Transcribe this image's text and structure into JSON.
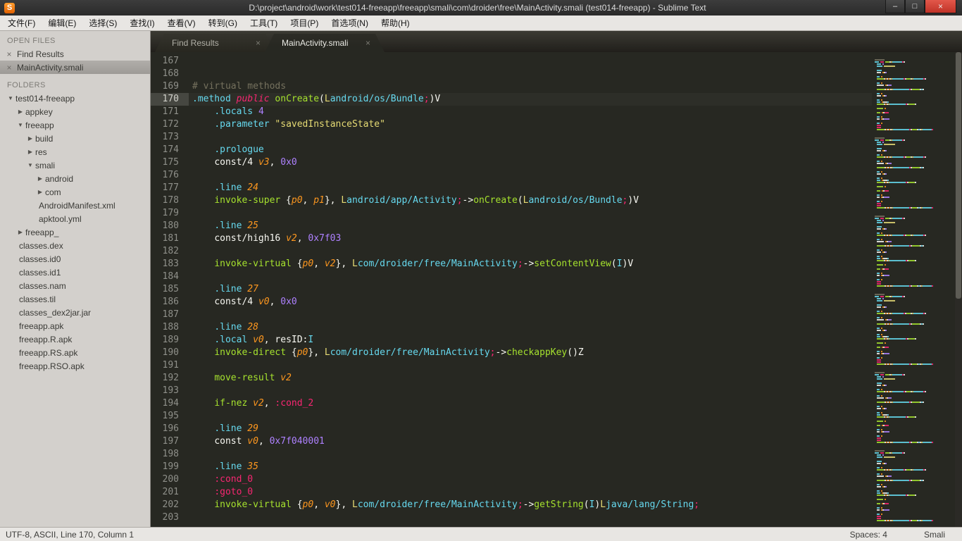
{
  "window": {
    "title": "D:\\project\\android\\work\\test014-freeapp\\freeapp\\smali\\com\\droider\\free\\MainActivity.smali (test014-freeapp) - Sublime Text",
    "controls": {
      "minimize": "–",
      "maximize": "□",
      "close": "×"
    },
    "app_icon_letter": "S"
  },
  "menu_bar": {
    "items": [
      "文件(F)",
      "编辑(E)",
      "选择(S)",
      "查找(I)",
      "查看(V)",
      "转到(G)",
      "工具(T)",
      "项目(P)",
      "首选项(N)",
      "帮助(H)"
    ]
  },
  "sidebar": {
    "open_files_header": "OPEN FILES",
    "open_files": [
      {
        "label": "Find Results",
        "selected": false
      },
      {
        "label": "MainActivity.smali",
        "selected": true
      }
    ],
    "folders_header": "FOLDERS",
    "tree": [
      {
        "label": "test014-freeapp",
        "level": 0,
        "type": "folder",
        "expanded": true
      },
      {
        "label": "appkey",
        "level": 1,
        "type": "folder",
        "expanded": false
      },
      {
        "label": "freeapp",
        "level": 1,
        "type": "folder",
        "expanded": true
      },
      {
        "label": "build",
        "level": 2,
        "type": "folder",
        "expanded": false
      },
      {
        "label": "res",
        "level": 2,
        "type": "folder",
        "expanded": false
      },
      {
        "label": "smali",
        "level": 2,
        "type": "folder",
        "expanded": true
      },
      {
        "label": "android",
        "level": 3,
        "type": "folder",
        "expanded": false
      },
      {
        "label": "com",
        "level": 3,
        "type": "folder",
        "expanded": false
      },
      {
        "label": "AndroidManifest.xml",
        "level": 3,
        "type": "file"
      },
      {
        "label": "apktool.yml",
        "level": 3,
        "type": "file"
      },
      {
        "label": "freeapp_",
        "level": 1,
        "type": "folder",
        "expanded": false
      },
      {
        "label": "classes.dex",
        "level": 1,
        "type": "file"
      },
      {
        "label": "classes.id0",
        "level": 1,
        "type": "file"
      },
      {
        "label": "classes.id1",
        "level": 1,
        "type": "file"
      },
      {
        "label": "classes.nam",
        "level": 1,
        "type": "file"
      },
      {
        "label": "classes.til",
        "level": 1,
        "type": "file"
      },
      {
        "label": "classes_dex2jar.jar",
        "level": 1,
        "type": "file"
      },
      {
        "label": "freeapp.apk",
        "level": 1,
        "type": "file"
      },
      {
        "label": "freeapp.R.apk",
        "level": 1,
        "type": "file"
      },
      {
        "label": "freeapp.RS.apk",
        "level": 1,
        "type": "file"
      },
      {
        "label": "freeapp.RSO.apk",
        "level": 1,
        "type": "file"
      }
    ]
  },
  "tabs": [
    {
      "label": "Find Results",
      "active": false
    },
    {
      "label": "MainActivity.smali",
      "active": true
    }
  ],
  "editor": {
    "active_line": 170,
    "lines": [
      {
        "num": 167,
        "tokens": []
      },
      {
        "num": 168,
        "tokens": []
      },
      {
        "num": 169,
        "tokens": [
          [
            "cm",
            "# virtual methods"
          ]
        ]
      },
      {
        "num": 170,
        "tokens": [
          [
            "c",
            ".method"
          ],
          [
            "w",
            " "
          ],
          [
            "pi",
            "public"
          ],
          [
            "w",
            " "
          ],
          [
            "g",
            "onCreate"
          ],
          [
            "w",
            "("
          ],
          [
            "y",
            "L"
          ],
          [
            "c",
            "android/os/Bundle"
          ],
          [
            "p",
            ";"
          ],
          [
            "w",
            ")V"
          ]
        ]
      },
      {
        "num": 171,
        "tokens": [
          [
            "w",
            "    "
          ],
          [
            "c",
            ".locals"
          ],
          [
            "w",
            " "
          ],
          [
            "n",
            "4"
          ]
        ]
      },
      {
        "num": 172,
        "tokens": [
          [
            "w",
            "    "
          ],
          [
            "c",
            ".parameter"
          ],
          [
            "w",
            " "
          ],
          [
            "y",
            "\"savedInstanceState\""
          ]
        ]
      },
      {
        "num": 173,
        "tokens": []
      },
      {
        "num": 174,
        "tokens": [
          [
            "w",
            "    "
          ],
          [
            "c",
            ".prologue"
          ]
        ]
      },
      {
        "num": 175,
        "tokens": [
          [
            "w",
            "    "
          ],
          [
            "w",
            "const/4"
          ],
          [
            "w",
            " "
          ],
          [
            "o",
            "v3"
          ],
          [
            "w",
            ", "
          ],
          [
            "n",
            "0x0"
          ]
        ]
      },
      {
        "num": 176,
        "tokens": []
      },
      {
        "num": 177,
        "tokens": [
          [
            "w",
            "    "
          ],
          [
            "c",
            ".line"
          ],
          [
            "w",
            " "
          ],
          [
            "o",
            "24"
          ]
        ]
      },
      {
        "num": 178,
        "tokens": [
          [
            "w",
            "    "
          ],
          [
            "g",
            "invoke-super"
          ],
          [
            "w",
            " {"
          ],
          [
            "o",
            "p0"
          ],
          [
            "w",
            ", "
          ],
          [
            "o",
            "p1"
          ],
          [
            "w",
            "}, "
          ],
          [
            "y",
            "L"
          ],
          [
            "c",
            "android/app/Activity"
          ],
          [
            "p",
            ";"
          ],
          [
            "w",
            "->"
          ],
          [
            "g",
            "onCreate"
          ],
          [
            "w",
            "("
          ],
          [
            "y",
            "L"
          ],
          [
            "c",
            "android/os/Bundle"
          ],
          [
            "p",
            ";"
          ],
          [
            "w",
            ")V"
          ]
        ]
      },
      {
        "num": 179,
        "tokens": []
      },
      {
        "num": 180,
        "tokens": [
          [
            "w",
            "    "
          ],
          [
            "c",
            ".line"
          ],
          [
            "w",
            " "
          ],
          [
            "o",
            "25"
          ]
        ]
      },
      {
        "num": 181,
        "tokens": [
          [
            "w",
            "    "
          ],
          [
            "w",
            "const/high16"
          ],
          [
            "w",
            " "
          ],
          [
            "o",
            "v2"
          ],
          [
            "w",
            ", "
          ],
          [
            "n",
            "0x7f03"
          ]
        ]
      },
      {
        "num": 182,
        "tokens": []
      },
      {
        "num": 183,
        "tokens": [
          [
            "w",
            "    "
          ],
          [
            "g",
            "invoke-virtual"
          ],
          [
            "w",
            " {"
          ],
          [
            "o",
            "p0"
          ],
          [
            "w",
            ", "
          ],
          [
            "o",
            "v2"
          ],
          [
            "w",
            "}, "
          ],
          [
            "y",
            "L"
          ],
          [
            "c",
            "com/droider/free/MainActivity"
          ],
          [
            "p",
            ";"
          ],
          [
            "w",
            "->"
          ],
          [
            "g",
            "setContentView"
          ],
          [
            "w",
            "("
          ],
          [
            "c",
            "I"
          ],
          [
            "w",
            ")V"
          ]
        ]
      },
      {
        "num": 184,
        "tokens": []
      },
      {
        "num": 185,
        "tokens": [
          [
            "w",
            "    "
          ],
          [
            "c",
            ".line"
          ],
          [
            "w",
            " "
          ],
          [
            "o",
            "27"
          ]
        ]
      },
      {
        "num": 186,
        "tokens": [
          [
            "w",
            "    "
          ],
          [
            "w",
            "const/4"
          ],
          [
            "w",
            " "
          ],
          [
            "o",
            "v0"
          ],
          [
            "w",
            ", "
          ],
          [
            "n",
            "0x0"
          ]
        ]
      },
      {
        "num": 187,
        "tokens": []
      },
      {
        "num": 188,
        "tokens": [
          [
            "w",
            "    "
          ],
          [
            "c",
            ".line"
          ],
          [
            "w",
            " "
          ],
          [
            "o",
            "28"
          ]
        ]
      },
      {
        "num": 189,
        "tokens": [
          [
            "w",
            "    "
          ],
          [
            "c",
            ".local"
          ],
          [
            "w",
            " "
          ],
          [
            "o",
            "v0"
          ],
          [
            "w",
            ", resID:"
          ],
          [
            "c",
            "I"
          ]
        ]
      },
      {
        "num": 190,
        "tokens": [
          [
            "w",
            "    "
          ],
          [
            "g",
            "invoke-direct"
          ],
          [
            "w",
            " {"
          ],
          [
            "o",
            "p0"
          ],
          [
            "w",
            "}, "
          ],
          [
            "y",
            "L"
          ],
          [
            "c",
            "com/droider/free/MainActivity"
          ],
          [
            "p",
            ";"
          ],
          [
            "w",
            "->"
          ],
          [
            "g",
            "checkappKey"
          ],
          [
            "w",
            "()Z"
          ]
        ]
      },
      {
        "num": 191,
        "tokens": []
      },
      {
        "num": 192,
        "tokens": [
          [
            "w",
            "    "
          ],
          [
            "g",
            "move-result"
          ],
          [
            "w",
            " "
          ],
          [
            "o",
            "v2"
          ]
        ]
      },
      {
        "num": 193,
        "tokens": []
      },
      {
        "num": 194,
        "tokens": [
          [
            "w",
            "    "
          ],
          [
            "g",
            "if-nez"
          ],
          [
            "w",
            " "
          ],
          [
            "o",
            "v2"
          ],
          [
            "w",
            ", "
          ],
          [
            "p",
            ":cond_2"
          ]
        ]
      },
      {
        "num": 195,
        "tokens": []
      },
      {
        "num": 196,
        "tokens": [
          [
            "w",
            "    "
          ],
          [
            "c",
            ".line"
          ],
          [
            "w",
            " "
          ],
          [
            "o",
            "29"
          ]
        ]
      },
      {
        "num": 197,
        "tokens": [
          [
            "w",
            "    "
          ],
          [
            "w",
            "const"
          ],
          [
            "w",
            " "
          ],
          [
            "o",
            "v0"
          ],
          [
            "w",
            ", "
          ],
          [
            "n",
            "0x7f040001"
          ]
        ]
      },
      {
        "num": 198,
        "tokens": []
      },
      {
        "num": 199,
        "tokens": [
          [
            "w",
            "    "
          ],
          [
            "c",
            ".line"
          ],
          [
            "w",
            " "
          ],
          [
            "o",
            "35"
          ]
        ]
      },
      {
        "num": 200,
        "tokens": [
          [
            "w",
            "    "
          ],
          [
            "p",
            ":cond_0"
          ]
        ]
      },
      {
        "num": 201,
        "tokens": [
          [
            "w",
            "    "
          ],
          [
            "p",
            ":goto_0"
          ]
        ]
      },
      {
        "num": 202,
        "tokens": [
          [
            "w",
            "    "
          ],
          [
            "g",
            "invoke-virtual"
          ],
          [
            "w",
            " {"
          ],
          [
            "o",
            "p0"
          ],
          [
            "w",
            ", "
          ],
          [
            "o",
            "v0"
          ],
          [
            "w",
            "}, "
          ],
          [
            "y",
            "L"
          ],
          [
            "c",
            "com/droider/free/MainActivity"
          ],
          [
            "p",
            ";"
          ],
          [
            "w",
            "->"
          ],
          [
            "g",
            "getString"
          ],
          [
            "w",
            "("
          ],
          [
            "c",
            "I"
          ],
          [
            "w",
            ")"
          ],
          [
            "y",
            "L"
          ],
          [
            "c",
            "java/lang/String"
          ],
          [
            "p",
            ";"
          ]
        ]
      },
      {
        "num": 203,
        "tokens": []
      }
    ]
  },
  "status_bar": {
    "left": "UTF-8, ASCII, Line 170, Column 1",
    "spaces": "Spaces: 4",
    "syntax": "Smali"
  },
  "colors": {
    "editor_bg": "#272822",
    "sidebar_bg": "#d3d0cc",
    "close_button": "#c9382c",
    "tokens": {
      "w": "#f8f8f2",
      "c": "#66d9ef",
      "p": "#f92672",
      "pi": "#f92672",
      "g": "#a6e22e",
      "o": "#fd971f",
      "n": "#ae81ff",
      "y": "#e6db74",
      "cm": "#75715e"
    }
  }
}
